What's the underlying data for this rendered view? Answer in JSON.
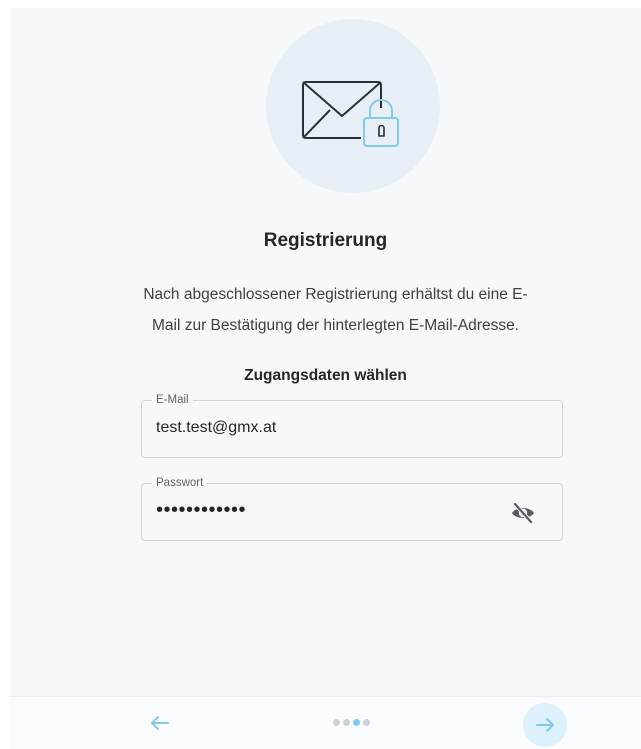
{
  "header": {
    "title": "Registrierung",
    "description": "Nach abgeschlossener Registrierung erhältst du eine E-Mail zur Bestätigung der hinterlegten E-Mail-Adresse.",
    "icon": "envelope-lock-icon"
  },
  "form": {
    "section_title": "Zugangsdaten wählen",
    "email": {
      "label": "E-Mail",
      "value": "test.test@gmx.at"
    },
    "password": {
      "label": "Passwort",
      "value": "••••••••••••",
      "toggle_icon": "eye-slash-icon"
    }
  },
  "footer": {
    "back_icon": "arrow-left-icon",
    "next_icon": "arrow-right-icon",
    "steps_total": 4,
    "steps_current": 3
  },
  "colors": {
    "accent": "#7fcbeb",
    "hero_bg": "#e8eef5",
    "next_bg": "#dcf1fb",
    "panel_bg": "#f7f8f9"
  }
}
